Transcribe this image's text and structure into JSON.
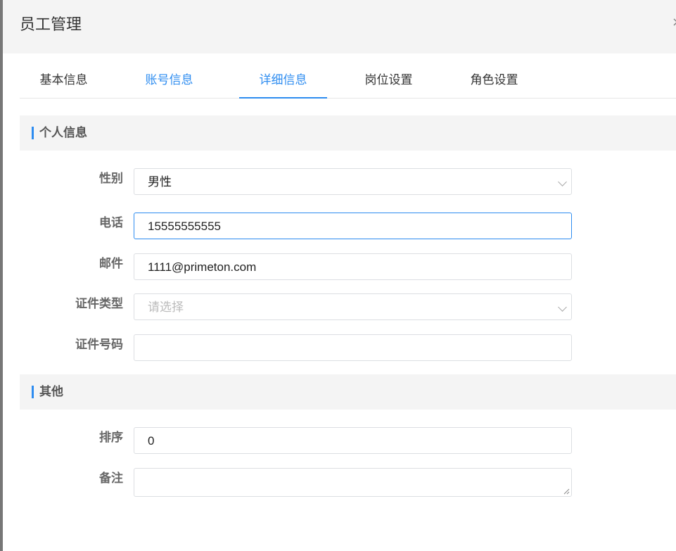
{
  "dialog": {
    "title": "员工管理",
    "close_glyph": "×"
  },
  "tabs": [
    {
      "label": "基本信息"
    },
    {
      "label": "账号信息"
    },
    {
      "label": "详细信息"
    },
    {
      "label": "岗位设置"
    },
    {
      "label": "角色设置"
    }
  ],
  "sections": {
    "personal": {
      "title": "个人信息"
    },
    "other": {
      "title": "其他"
    }
  },
  "form": {
    "gender": {
      "label": "性别",
      "value": "男性"
    },
    "phone": {
      "label": "电话",
      "value": "15555555555"
    },
    "email": {
      "label": "邮件",
      "value": "1111@primeton.com"
    },
    "id_type": {
      "label": "证件类型",
      "placeholder": "请选择"
    },
    "id_number": {
      "label": "证件号码",
      "value": ""
    },
    "sort": {
      "label": "排序",
      "value": "0"
    },
    "remark": {
      "label": "备注",
      "value": ""
    }
  },
  "colors": {
    "accent": "#2d8cf0",
    "header_bg": "#f4f4f4",
    "border": "#dcdee2"
  }
}
